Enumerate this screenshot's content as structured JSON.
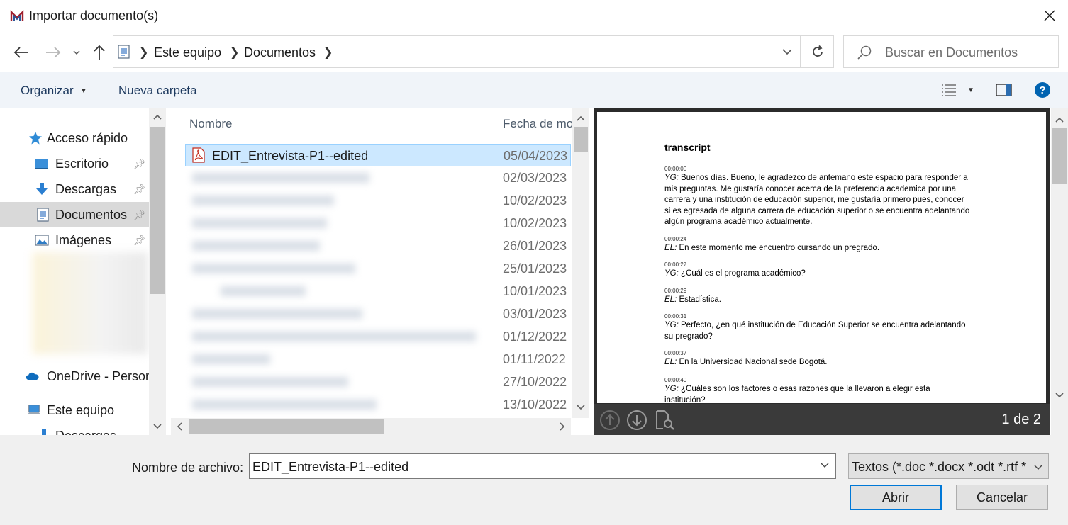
{
  "window": {
    "title": "Importar documento(s)",
    "close_icon": "close-icon",
    "app_icon": "mendeley-logo-icon"
  },
  "address": {
    "crumbs": [
      "Este equipo",
      "Documentos"
    ],
    "search_placeholder": "Buscar en Documentos"
  },
  "toolbar": {
    "organize_label": "Organizar",
    "new_folder_label": "Nueva carpeta"
  },
  "nav": {
    "quick_access_label": "Acceso rápido",
    "items": [
      {
        "label": "Escritorio",
        "icon": "desktop-folder-icon",
        "pinned": true
      },
      {
        "label": "Descargas",
        "icon": "downloads-folder-icon",
        "pinned": true
      },
      {
        "label": "Documentos",
        "icon": "documents-folder-icon",
        "pinned": true,
        "selected": true
      },
      {
        "label": "Imágenes",
        "icon": "pictures-folder-icon",
        "pinned": true
      }
    ],
    "onedrive_label": "OneDrive - Person",
    "this_pc_label": "Este equipo",
    "downloads_sub_label": "Descargas"
  },
  "filelist": {
    "columns": [
      "Nombre",
      "Fecha de mo"
    ],
    "rows": [
      {
        "name": "EDIT_Entrevista-P1--edited",
        "date": "05/04/2023",
        "selected": true
      },
      {
        "name": "",
        "date": "02/03/2023"
      },
      {
        "name": "",
        "date": "10/02/2023"
      },
      {
        "name": "",
        "date": "10/02/2023"
      },
      {
        "name": "",
        "date": "26/01/2023"
      },
      {
        "name": "",
        "date": "25/01/2023"
      },
      {
        "name": "",
        "date": "10/01/2023"
      },
      {
        "name": "",
        "date": "03/01/2023"
      },
      {
        "name": "",
        "date": "01/12/2022"
      },
      {
        "name": "",
        "date": "01/11/2022"
      },
      {
        "name": "",
        "date": "27/10/2022"
      },
      {
        "name": "",
        "date": "13/10/2022"
      }
    ]
  },
  "preview": {
    "doc_title": "transcript",
    "entries": [
      {
        "time": "00:00:00",
        "speaker": "YG:",
        "lines": [
          " Buenos días. Bueno, le agradezco de antemano este espacio para responder a",
          "mis preguntas. Me gustaría conocer acerca de la preferencia academica por una",
          "carrera y una institución de educación superior, me gustaría primero pues, conocer",
          "si es egresada de alguna carrera de educación superior o se encuentra adelantando",
          "algún programa académico actualmente."
        ]
      },
      {
        "time": "00:00:24",
        "speaker": "EL:",
        "lines": [
          " En este momento me encuentro cursando un pregrado."
        ]
      },
      {
        "time": "00:00:27",
        "speaker": "YG:",
        "lines": [
          " ¿Cuál es el programa académico?"
        ]
      },
      {
        "time": "00:00:29",
        "speaker": "EL:",
        "lines": [
          " Estadística."
        ]
      },
      {
        "time": "00:00:31",
        "speaker": "YG:",
        "lines": [
          " Perfecto, ¿en qué institución de Educación Superior se encuentra adelantando",
          "su pregrado?"
        ]
      },
      {
        "time": "00:00:37",
        "speaker": "EL:",
        "lines": [
          " En la Universidad Nacional sede Bogotá."
        ]
      },
      {
        "time": "00:00:40",
        "speaker": "YG:",
        "lines": [
          " ¿Cuáles son los factores o esas razones que la llevaron a elegir esta",
          "institución?"
        ]
      }
    ],
    "page_count": "1 de 2"
  },
  "bottom": {
    "filename_label": "Nombre de archivo:",
    "filename_value": "EDIT_Entrevista-P1--edited",
    "filter_value": "Textos (*.doc *.docx *.odt *.rtf *",
    "open_label": "Abrir",
    "cancel_label": "Cancelar"
  },
  "colors": {
    "accent": "#0078d7",
    "selection": "#cce8ff",
    "help": "#0063b1"
  }
}
